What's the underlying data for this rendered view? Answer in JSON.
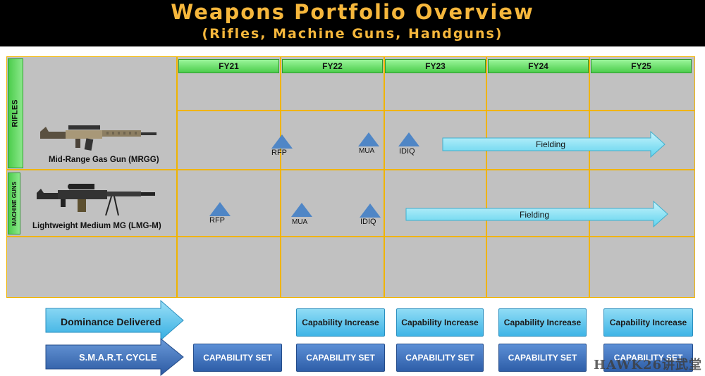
{
  "header": {
    "title": "Weapons Portfolio Overview",
    "subtitle": "(Rifles, Machine Guns, Handguns)"
  },
  "years": [
    "FY21",
    "FY22",
    "FY23",
    "FY24",
    "FY25"
  ],
  "rows": {
    "rifles": {
      "label": "RIFLES",
      "weapon": "Mid-Range Gas Gun (MRGG)",
      "milestones": [
        "RFP",
        "MUA",
        "IDIQ"
      ],
      "arrow_label": "Fielding"
    },
    "machine_guns": {
      "label": "MACHINE GUNS",
      "weapon": "Lightweight Medium MG (LMG-M)",
      "milestones": [
        "RFP",
        "MUA",
        "IDIQ"
      ],
      "arrow_label": "Fielding"
    }
  },
  "bottom": {
    "dominance_label": "Dominance Delivered",
    "smart_label": "S.M.A.R.T. CYCLE",
    "capability_increase": [
      "Capability Increase",
      "Capability Increase",
      "Capability Increase",
      "Capability Increase"
    ],
    "capability_set": [
      "CAPABILITY SET",
      "CAPABILITY SET",
      "CAPABILITY SET",
      "CAPABILITY SET",
      "CAPABILITY SET"
    ]
  },
  "watermark": "HAWK26讲武堂",
  "colors": {
    "header_text": "#f6b73c",
    "fy_green": "#4ccd4c",
    "grid_line": "#f0b400",
    "triangle": "#4f86c6",
    "fielding_arrow": "#8fe6f8",
    "cap_increase": "#3fb4e6",
    "cap_set": "#2e5ea8"
  }
}
